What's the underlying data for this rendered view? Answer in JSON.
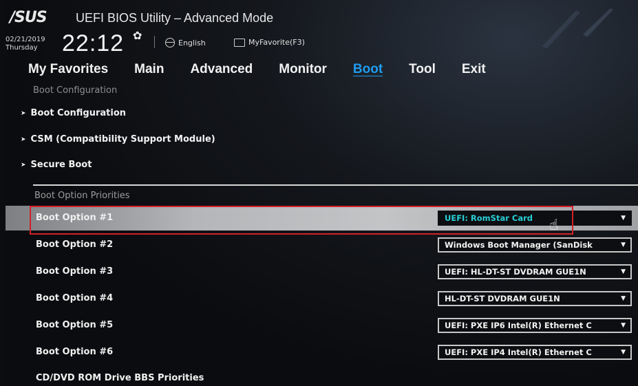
{
  "header": {
    "logo": "/SUS",
    "title": "UEFI BIOS Utility – Advanced Mode",
    "date": "02/21/2019",
    "day": "Thursday",
    "time": "22:12",
    "language": "English",
    "favorite": "MyFavorite(F3)"
  },
  "tabs": [
    {
      "label": "My Favorites"
    },
    {
      "label": "Main"
    },
    {
      "label": "Advanced"
    },
    {
      "label": "Monitor"
    },
    {
      "label": "Boot",
      "active": true
    },
    {
      "label": "Tool"
    },
    {
      "label": "Exit"
    }
  ],
  "breadcrumb": "Boot Configuration",
  "menu": [
    {
      "label": "Boot Configuration"
    },
    {
      "label": "CSM (Compatibility Support Module)"
    },
    {
      "label": "Secure Boot"
    }
  ],
  "section_title": "Boot Option Priorities",
  "boot_options": [
    {
      "label": "Boot Option #1",
      "value": "UEFI: RomStar Card",
      "selected": true
    },
    {
      "label": "Boot Option #2",
      "value": "Windows Boot Manager (SanDisk"
    },
    {
      "label": "Boot Option #3",
      "value": "UEFI: HL-DT-ST DVDRAM GUE1N"
    },
    {
      "label": "Boot Option #4",
      "value": "HL-DT-ST DVDRAM GUE1N"
    },
    {
      "label": "Boot Option #5",
      "value": "UEFI: PXE IP6 Intel(R) Ethernet C"
    },
    {
      "label": "Boot Option #6",
      "value": "UEFI: PXE IP4 Intel(R) Ethernet C"
    }
  ],
  "footer_item": "CD/DVD ROM Drive BBS Priorities",
  "colors": {
    "active_tab": "#1f9cf0",
    "selected_value": "#28d0d8",
    "highlight_box": "#d22028"
  }
}
